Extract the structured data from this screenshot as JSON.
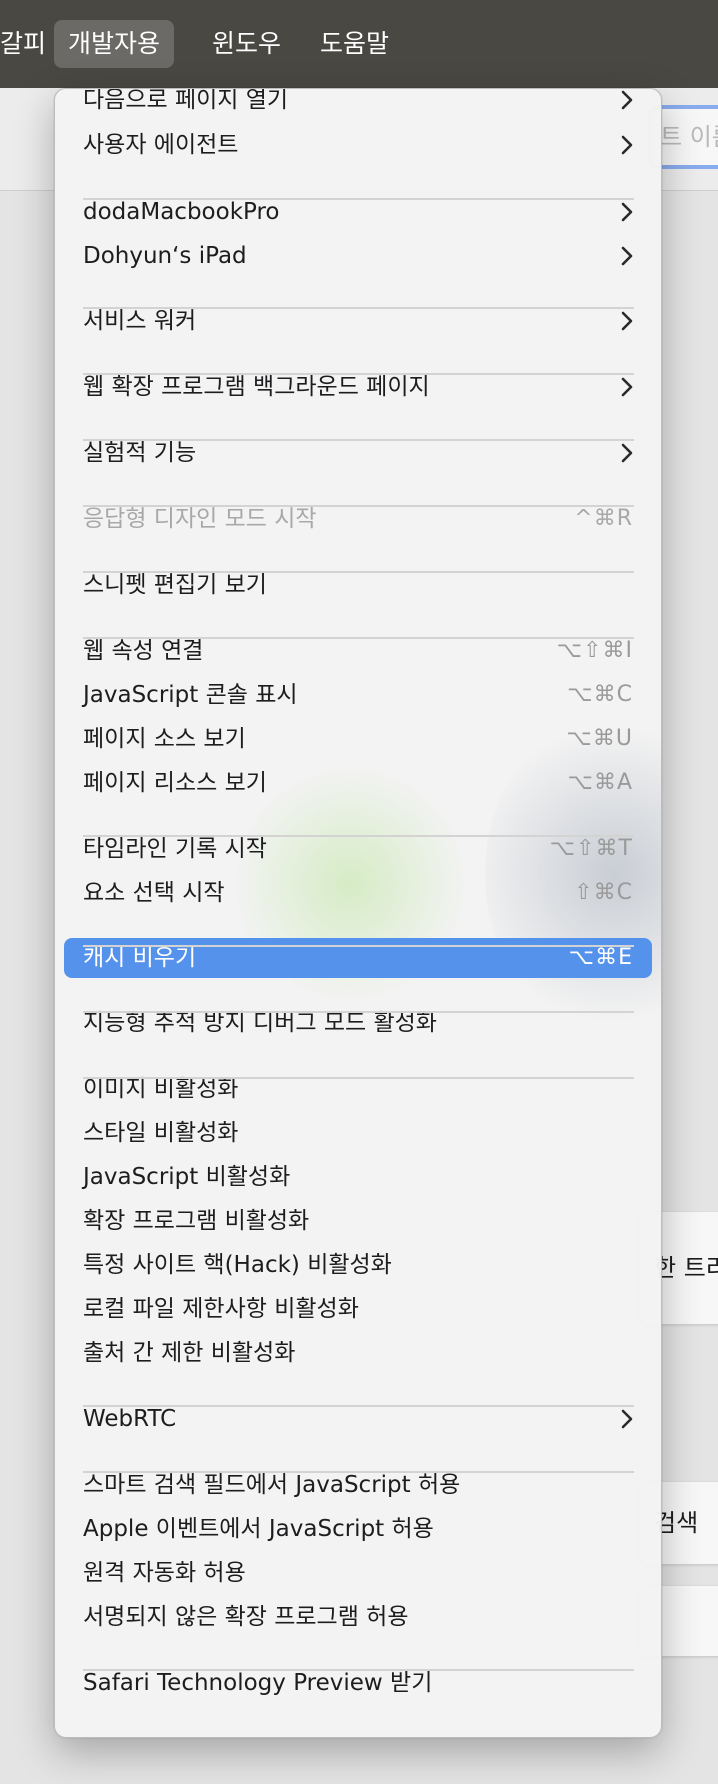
{
  "menubar": {
    "items": [
      "갈피",
      "개발자용",
      "윈도우",
      "도움말"
    ]
  },
  "background": {
    "search_placeholder": "트 이름",
    "card1_text": "한 트리",
    "card2_text": "검색"
  },
  "menu": {
    "items": [
      {
        "label": "다음으로 페이지 열기",
        "submenu": true
      },
      {
        "label": "사용자 에이전트",
        "submenu": true
      },
      {
        "label": "dodaMacbookPro",
        "submenu": true
      },
      {
        "label": "Dohyun‘s iPad",
        "submenu": true
      },
      {
        "label": "서비스 워커",
        "submenu": true
      },
      {
        "label": "웹 확장 프로그램 백그라운드 페이지",
        "submenu": true
      },
      {
        "label": "실험적 기능",
        "submenu": true
      },
      {
        "label": "응답형 디자인 모드 시작",
        "shortcut": "^⌘R",
        "disabled": true
      },
      {
        "label": "스니펫 편집기 보기"
      },
      {
        "label": "웹 속성 연결",
        "shortcut": "⌥⇧⌘I"
      },
      {
        "label": "JavaScript 콘솔 표시",
        "shortcut": "⌥⌘C"
      },
      {
        "label": "페이지 소스 보기",
        "shortcut": "⌥⌘U"
      },
      {
        "label": "페이지 리소스 보기",
        "shortcut": "⌥⌘A"
      },
      {
        "label": "타임라인 기록 시작",
        "shortcut": "⌥⇧⌘T"
      },
      {
        "label": "요소 선택 시작",
        "shortcut": "⇧⌘C"
      },
      {
        "label": "캐시 비우기",
        "shortcut": "⌥⌘E",
        "highlighted": true
      },
      {
        "label": "지능형 추적 방지 디버그 모드 활성화"
      },
      {
        "label": "이미지 비활성화"
      },
      {
        "label": "스타일 비활성화"
      },
      {
        "label": "JavaScript 비활성화"
      },
      {
        "label": "확장 프로그램 비활성화"
      },
      {
        "label": "특정 사이트 핵(Hack) 비활성화"
      },
      {
        "label": "로컬 파일 제한사항 비활성화"
      },
      {
        "label": "출처 간 제한 비활성화"
      },
      {
        "label": "WebRTC",
        "submenu": true
      },
      {
        "label": "스마트 검색 필드에서 JavaScript 허용"
      },
      {
        "label": "Apple 이벤트에서 JavaScript 허용"
      },
      {
        "label": "원격 자동화 허용"
      },
      {
        "label": "서명되지 않은 확장 프로그램 허용"
      },
      {
        "label": "Safari Technology Preview 받기"
      }
    ]
  },
  "colors": {
    "menubar_bg": "#4a4843",
    "highlight": "#5592ec",
    "disabled_text": "#a8a8a8",
    "shortcut_text": "#9a9a9a"
  }
}
